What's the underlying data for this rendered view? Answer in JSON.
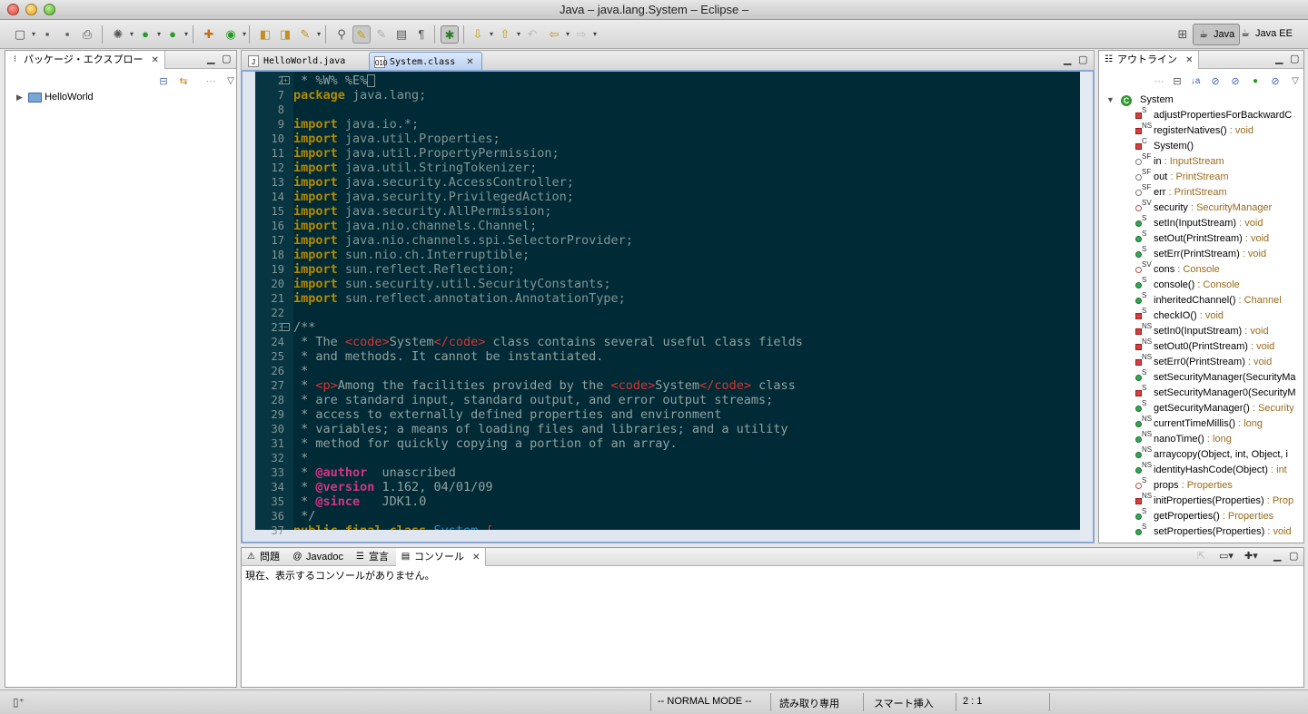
{
  "window": {
    "title": "Java – java.lang.System – Eclipse –"
  },
  "perspectives": [
    {
      "label": "Java",
      "icon": "java-perspective-icon"
    },
    {
      "label": "Java EE",
      "icon": "javaee-perspective-icon"
    }
  ],
  "package_explorer": {
    "title": "パッケージ・エクスプロー",
    "items": [
      {
        "label": "HelloWorld"
      }
    ]
  },
  "editor": {
    "tabs": [
      {
        "label": "HelloWorld.java"
      },
      {
        "label": "System.class"
      }
    ],
    "lines": [
      {
        "n": "2",
        "html": " <span class=\"cm\">* %W% %E%</span><span class=\"cursor-box\"></span>"
      },
      {
        "n": "7",
        "html": "<span class=\"kw\">package</span> java.lang;"
      },
      {
        "n": "8",
        "html": ""
      },
      {
        "n": "9",
        "html": "<span class=\"kw\">import</span> java.io.*;"
      },
      {
        "n": "10",
        "html": "<span class=\"kw\">import</span> java.util.Properties;"
      },
      {
        "n": "11",
        "html": "<span class=\"kw\">import</span> java.util.PropertyPermission;"
      },
      {
        "n": "12",
        "html": "<span class=\"kw\">import</span> java.util.StringTokenizer;"
      },
      {
        "n": "13",
        "html": "<span class=\"kw\">import</span> java.security.AccessController;"
      },
      {
        "n": "14",
        "html": "<span class=\"kw\">import</span> java.security.PrivilegedAction;"
      },
      {
        "n": "15",
        "html": "<span class=\"kw\">import</span> java.security.AllPermission;"
      },
      {
        "n": "16",
        "html": "<span class=\"kw\">import</span> java.nio.channels.Channel;"
      },
      {
        "n": "17",
        "html": "<span class=\"kw\">import</span> java.nio.channels.spi.SelectorProvider;"
      },
      {
        "n": "18",
        "html": "<span class=\"kw\">import</span> sun.nio.ch.Interruptible;"
      },
      {
        "n": "19",
        "html": "<span class=\"kw\">import</span> sun.reflect.Reflection;"
      },
      {
        "n": "20",
        "html": "<span class=\"kw\">import</span> sun.security.util.SecurityConstants;"
      },
      {
        "n": "21",
        "html": "<span class=\"kw\">import</span> sun.reflect.annotation.AnnotationType;"
      },
      {
        "n": "22",
        "html": ""
      },
      {
        "n": "23",
        "html": "<span class=\"cm\">/**</span>"
      },
      {
        "n": "24",
        "html": "<span class=\"cm\"> * The </span><span class=\"tg\">&lt;code&gt;</span><span class=\"cm\">System</span><span class=\"tg\">&lt;/code&gt;</span><span class=\"cm\"> class contains several useful class fields</span>"
      },
      {
        "n": "25",
        "html": "<span class=\"cm\"> * and methods. It cannot be instantiated.</span>"
      },
      {
        "n": "26",
        "html": "<span class=\"cm\"> *</span>"
      },
      {
        "n": "27",
        "html": "<span class=\"cm\"> * </span><span class=\"tg\">&lt;p&gt;</span><span class=\"cm\">Among the facilities provided by the </span><span class=\"tg\">&lt;code&gt;</span><span class=\"cm\">System</span><span class=\"tg\">&lt;/code&gt;</span><span class=\"cm\"> class</span>"
      },
      {
        "n": "28",
        "html": "<span class=\"cm\"> * are standard input, standard output, and error output streams;</span>"
      },
      {
        "n": "29",
        "html": "<span class=\"cm\"> * access to externally defined properties and environment</span>"
      },
      {
        "n": "30",
        "html": "<span class=\"cm\"> * variables; a means of loading files and libraries; and a utility</span>"
      },
      {
        "n": "31",
        "html": "<span class=\"cm\"> * method for quickly copying a portion of an array.</span>"
      },
      {
        "n": "32",
        "html": "<span class=\"cm\"> *</span>"
      },
      {
        "n": "33",
        "html": "<span class=\"cm\"> * </span><span class=\"an\">@author</span><span class=\"cm\">  unascribed</span>"
      },
      {
        "n": "34",
        "html": "<span class=\"cm\"> * </span><span class=\"an\">@version</span><span class=\"cm\"> 1.162, 04/01/09</span>"
      },
      {
        "n": "35",
        "html": "<span class=\"cm\"> * </span><span class=\"an\">@since</span><span class=\"cm\">   JDK1.0</span>"
      },
      {
        "n": "36",
        "html": "<span class=\"cm\"> */</span>"
      },
      {
        "n": "37",
        "html": "<span class=\"kw\">public final class</span> <span class=\"cls\">System</span> <span class=\"tg\">{</span>"
      }
    ]
  },
  "outline": {
    "title": "アウトライン",
    "root": "System",
    "members": [
      {
        "icon": "sq",
        "mod": "S",
        "name": "adjustPropertiesForBackwardC",
        "type": ""
      },
      {
        "icon": "sq",
        "mod": "NS",
        "name": "registerNatives()",
        "type": " : void"
      },
      {
        "icon": "sq",
        "mod": "C",
        "name": "System()",
        "type": ""
      },
      {
        "icon": "hs",
        "mod": "SF",
        "name": "in",
        "type": " : InputStream"
      },
      {
        "icon": "hs",
        "mod": "SF",
        "name": "out",
        "type": " : PrintStream"
      },
      {
        "icon": "hs",
        "mod": "SF",
        "name": "err",
        "type": " : PrintStream"
      },
      {
        "icon": "dk",
        "mod": "SV",
        "name": "security",
        "type": " : SecurityManager"
      },
      {
        "icon": "dot",
        "mod": "S",
        "name": "setIn(InputStream)",
        "type": " : void"
      },
      {
        "icon": "dot",
        "mod": "S",
        "name": "setOut(PrintStream)",
        "type": " : void"
      },
      {
        "icon": "dot",
        "mod": "S",
        "name": "setErr(PrintStream)",
        "type": " : void"
      },
      {
        "icon": "dk",
        "mod": "SV",
        "name": "cons",
        "type": " : Console"
      },
      {
        "icon": "dot",
        "mod": "S",
        "name": "console()",
        "type": " : Console"
      },
      {
        "icon": "dot",
        "mod": "S",
        "name": "inheritedChannel()",
        "type": " : Channel"
      },
      {
        "icon": "sq",
        "mod": "S",
        "name": "checkIO()",
        "type": " : void"
      },
      {
        "icon": "sq",
        "mod": "NS",
        "name": "setIn0(InputStream)",
        "type": " : void"
      },
      {
        "icon": "sq",
        "mod": "NS",
        "name": "setOut0(PrintStream)",
        "type": " : void"
      },
      {
        "icon": "sq",
        "mod": "NS",
        "name": "setErr0(PrintStream)",
        "type": " : void"
      },
      {
        "icon": "dot",
        "mod": "S",
        "name": "setSecurityManager(SecurityMa",
        "type": ""
      },
      {
        "icon": "sq",
        "mod": "S",
        "name": "setSecurityManager0(SecurityM",
        "type": ""
      },
      {
        "icon": "dot",
        "mod": "S",
        "name": "getSecurityManager()",
        "type": " : Security"
      },
      {
        "icon": "dot",
        "mod": "NS",
        "name": "currentTimeMillis()",
        "type": " : long"
      },
      {
        "icon": "dot",
        "mod": "NS",
        "name": "nanoTime()",
        "type": " : long"
      },
      {
        "icon": "dot",
        "mod": "NS",
        "name": "arraycopy(Object, int, Object, i",
        "type": ""
      },
      {
        "icon": "dot",
        "mod": "NS",
        "name": "identityHashCode(Object)",
        "type": " : int"
      },
      {
        "icon": "dk",
        "mod": "S",
        "name": "props",
        "type": " : Properties"
      },
      {
        "icon": "sq",
        "mod": "NS",
        "name": "initProperties(Properties)",
        "type": " : Prop"
      },
      {
        "icon": "dot",
        "mod": "S",
        "name": "getProperties()",
        "type": " : Properties"
      },
      {
        "icon": "dot",
        "mod": "S",
        "name": "setProperties(Properties)",
        "type": " : void"
      }
    ]
  },
  "bottom": {
    "tabs": [
      {
        "label": "問題",
        "icon": "problems-icon"
      },
      {
        "label": "Javadoc",
        "icon": "javadoc-icon"
      },
      {
        "label": "宣言",
        "icon": "declaration-icon"
      },
      {
        "label": "コンソール",
        "icon": "console-icon"
      }
    ],
    "console_message": "現在、表示するコンソールがありません。"
  },
  "status": {
    "mode": "-- NORMAL MODE --",
    "writable": "読み取り専用",
    "insert": "スマート挿入",
    "position": "2 : 1"
  }
}
